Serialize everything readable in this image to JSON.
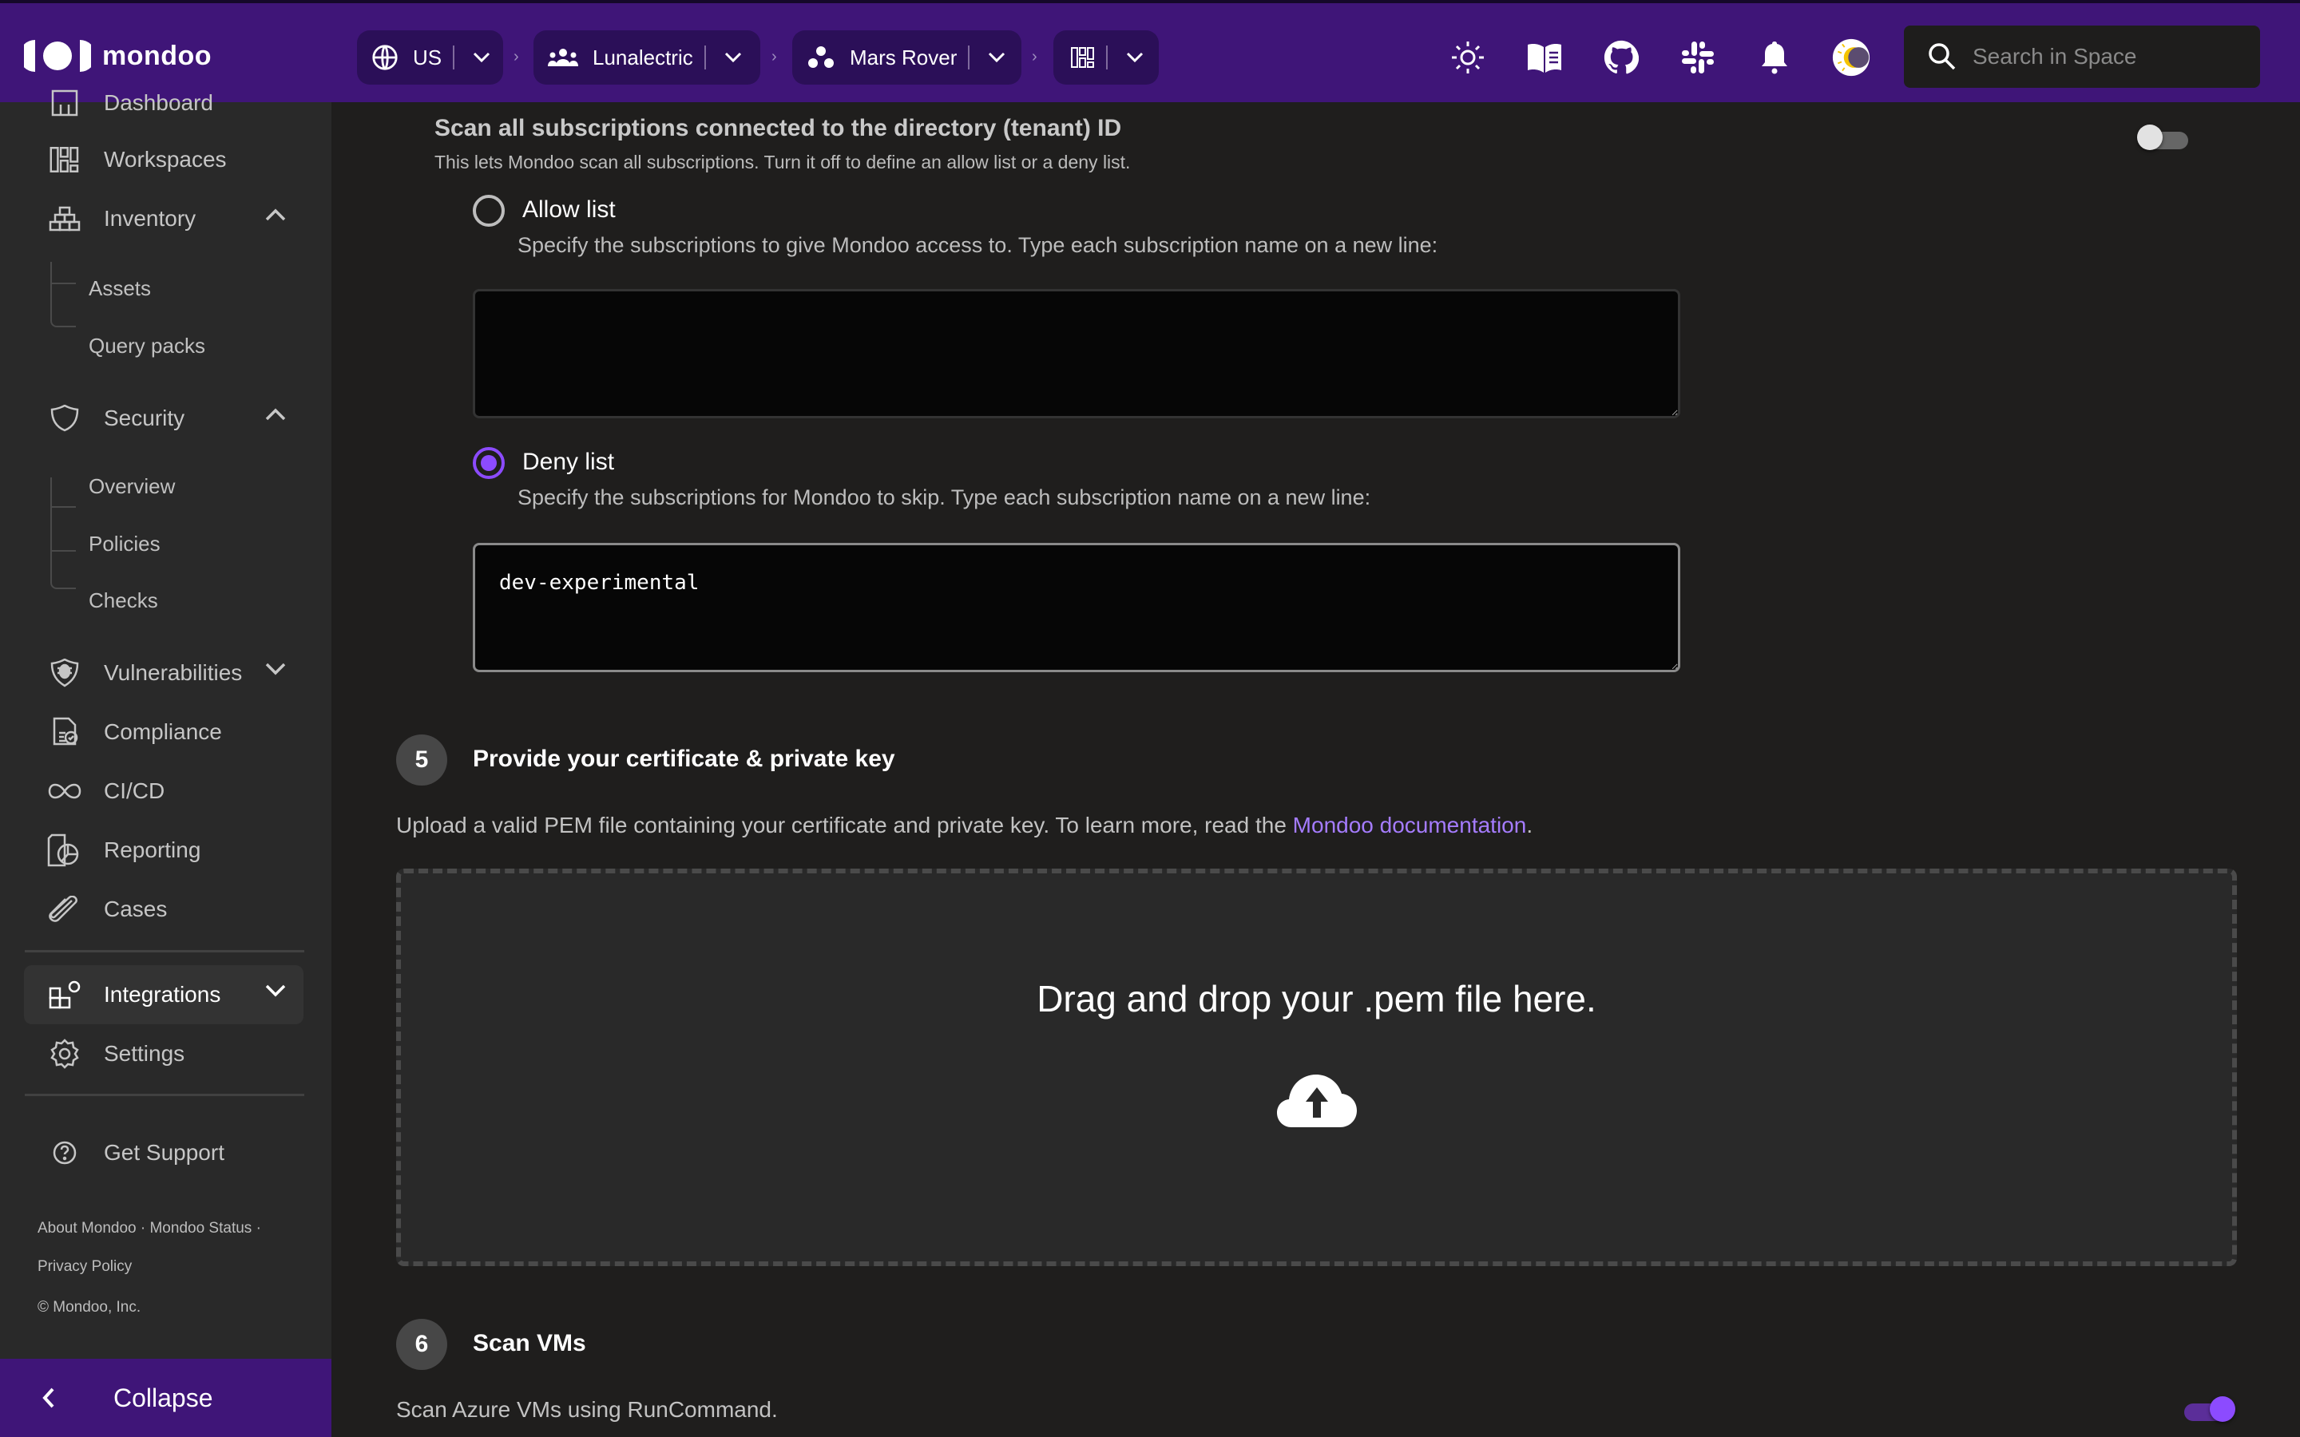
{
  "app": {
    "brand": "mondoo"
  },
  "header": {
    "breadcrumbs": [
      {
        "icon": "globe-icon",
        "label": "US"
      },
      {
        "icon": "team-icon",
        "label": "Lunalectric"
      },
      {
        "icon": "space-icon",
        "label": "Mars Rover"
      },
      {
        "icon": "workspaces-icon",
        "label": ""
      }
    ],
    "crumb_separator": "›",
    "icons": [
      "sun-icon",
      "docs-book-icon",
      "github-icon",
      "slack-icon",
      "bell-icon",
      "theme-toggle-icon"
    ],
    "search": {
      "placeholder": "Search in Space",
      "value": ""
    }
  },
  "sidebar": {
    "items": [
      {
        "label": "Dashboard"
      },
      {
        "label": "Workspaces"
      },
      {
        "label": "Inventory",
        "expanded": true,
        "children": [
          "Assets",
          "Query packs"
        ]
      },
      {
        "label": "Security",
        "expanded": true,
        "children": [
          "Overview",
          "Policies",
          "Checks"
        ]
      },
      {
        "label": "Vulnerabilities",
        "expanded": false
      },
      {
        "label": "Compliance"
      },
      {
        "label": "CI/CD"
      },
      {
        "label": "Reporting"
      },
      {
        "label": "Cases"
      },
      {
        "label": "Integrations",
        "expanded": false,
        "active": true
      },
      {
        "label": "Settings"
      }
    ],
    "support": "Get Support",
    "footer": {
      "about": "About Mondoo",
      "status": "Mondoo Status",
      "dot": "·",
      "privacy": "Privacy Policy",
      "copyright": "© Mondoo, Inc."
    },
    "collapse": "Collapse"
  },
  "main": {
    "scan_all": {
      "title": "Scan all subscriptions connected to the directory (tenant) ID",
      "description": "This lets Mondoo scan all subscriptions. Turn it off to define an allow list or a deny list.",
      "enabled": false
    },
    "allow_list": {
      "label": "Allow list",
      "selected": false,
      "description": "Specify the subscriptions to give Mondoo access to. Type each subscription name on a new line:",
      "value": ""
    },
    "deny_list": {
      "label": "Deny list",
      "selected": true,
      "description": "Specify the subscriptions for Mondoo to skip. Type each subscription name on a new line:",
      "value": "dev-experimental"
    },
    "step5": {
      "number": "5",
      "title": "Provide your certificate & private key",
      "text": "Upload a valid PEM file containing your certificate and private key. To learn more, read the ",
      "link": "Mondoo documentation",
      "text_end": ".",
      "dropzone": "Drag and drop your .pem file here."
    },
    "step6": {
      "number": "6",
      "title": "Scan VMs",
      "description": "Scan Azure VMs using RunCommand.",
      "enabled": true
    }
  },
  "colors": {
    "brand_purple": "#3f1578",
    "accent": "#8c4bff",
    "link": "#a57cff"
  }
}
